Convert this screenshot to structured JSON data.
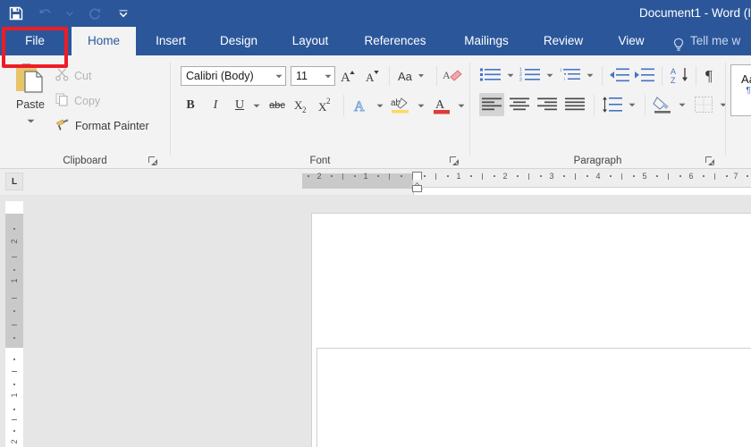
{
  "window": {
    "title": "Document1 - Word (I",
    "accent_color": "#2b579a",
    "ribbon_bg": "#f3f3f3",
    "annotation_color": "#ee1c25"
  },
  "quick_access": [
    {
      "name": "save-icon",
      "label": "Save",
      "enabled": true
    },
    {
      "name": "undo-icon",
      "label": "Undo",
      "enabled": false
    },
    {
      "name": "redo-icon",
      "label": "Redo",
      "enabled": false
    },
    {
      "name": "customize-quick-access-toolbar-icon",
      "label": "Customize Quick Access Toolbar",
      "enabled": true
    }
  ],
  "tabs": [
    {
      "label": "File",
      "active": false,
      "is_file": true
    },
    {
      "label": "Home",
      "active": true
    },
    {
      "label": "Insert",
      "active": false
    },
    {
      "label": "Design",
      "active": false
    },
    {
      "label": "Layout",
      "active": false
    },
    {
      "label": "References",
      "active": false
    },
    {
      "label": "Mailings",
      "active": false
    },
    {
      "label": "Review",
      "active": false
    },
    {
      "label": "View",
      "active": false
    }
  ],
  "tell_me": {
    "label": "Tell me w",
    "icon": "lightbulb-icon"
  },
  "ribbon": {
    "groups": [
      {
        "label": "Clipboard",
        "launcher": true
      },
      {
        "label": "Font",
        "launcher": true
      },
      {
        "label": "Paragraph",
        "launcher": true
      }
    ],
    "clipboard": {
      "paste": {
        "label": "Paste",
        "enabled": true,
        "has_dropdown": true
      },
      "items": [
        {
          "label": "Cut",
          "icon": "scissors-icon",
          "enabled": false
        },
        {
          "label": "Copy",
          "icon": "copy-icon",
          "enabled": false
        },
        {
          "label": "Format Painter",
          "icon": "paintbrush-icon",
          "enabled": true
        }
      ]
    },
    "font": {
      "family": {
        "value": "Calibri (Body)",
        "name": "font-family-combobox"
      },
      "size": {
        "value": "11",
        "name": "font-size-combobox"
      },
      "buttons": [
        {
          "name": "grow-font-icon",
          "glyph": "A"
        },
        {
          "name": "shrink-font-icon",
          "glyph": "A"
        },
        {
          "name": "change-case-icon",
          "glyph": "Aa"
        },
        {
          "name": "clear-formatting-icon",
          "glyph": "A"
        },
        {
          "name": "bold-icon",
          "glyph": "B"
        },
        {
          "name": "italic-icon",
          "glyph": "I"
        },
        {
          "name": "underline-icon",
          "glyph": "U"
        },
        {
          "name": "strikethrough-icon",
          "glyph": "abc"
        },
        {
          "name": "subscript-icon",
          "glyph": "X"
        },
        {
          "name": "superscript-icon",
          "glyph": "X"
        },
        {
          "name": "text-effects-icon",
          "glyph": "A"
        },
        {
          "name": "text-highlight-color-icon",
          "glyph": "ab"
        },
        {
          "name": "font-color-icon",
          "glyph": "A"
        }
      ]
    },
    "paragraph": {
      "buttons": [
        {
          "name": "bullets-icon"
        },
        {
          "name": "numbering-icon"
        },
        {
          "name": "multilevel-list-icon"
        },
        {
          "name": "decrease-indent-icon"
        },
        {
          "name": "increase-indent-icon"
        },
        {
          "name": "sort-icon"
        },
        {
          "name": "show-formatting-marks-icon"
        },
        {
          "name": "align-left-icon",
          "active": true
        },
        {
          "name": "align-center-icon"
        },
        {
          "name": "align-right-icon"
        },
        {
          "name": "justify-icon"
        },
        {
          "name": "line-spacing-icon"
        },
        {
          "name": "shading-icon"
        },
        {
          "name": "borders-icon"
        }
      ]
    },
    "styles": {
      "preview_aa": "Aa",
      "preview_pilcrow": "¶"
    }
  },
  "ruler": {
    "tab_selector": "L",
    "horizontal_margin_ticks": [
      "2",
      "1"
    ],
    "horizontal_page_ticks": [
      "1",
      "2",
      "3",
      "4",
      "5",
      "6",
      "7"
    ],
    "vertical_margin_ticks": [
      "2",
      "1"
    ],
    "vertical_page_ticks": [
      "1",
      "2"
    ]
  },
  "document": {
    "body_text": ""
  }
}
